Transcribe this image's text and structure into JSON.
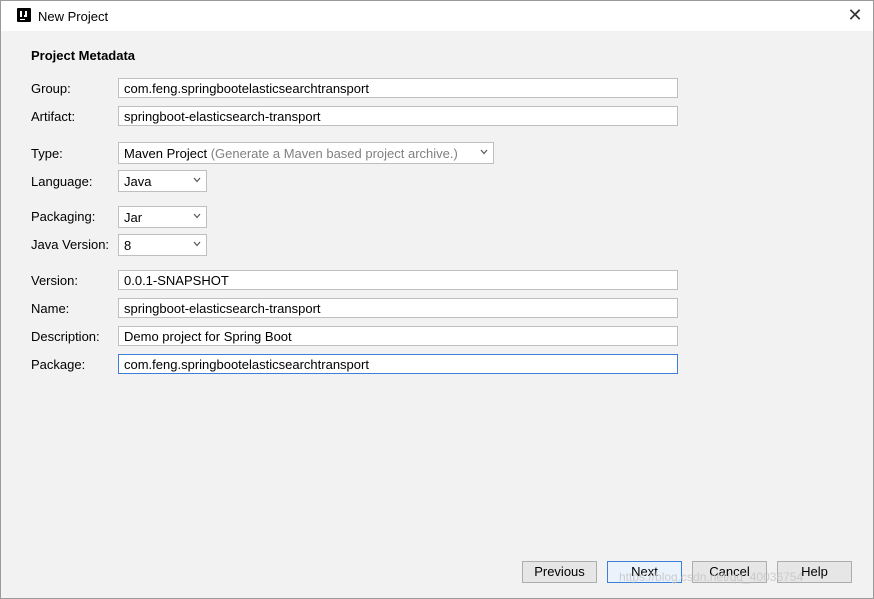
{
  "window": {
    "title": "New Project",
    "close_glyph": "✕"
  },
  "section": {
    "title": "Project Metadata"
  },
  "fields": {
    "group": {
      "label": "Group:",
      "value": "com.feng.springbootelasticsearchtransport"
    },
    "artifact": {
      "label": "Artifact:",
      "value": "springboot-elasticsearch-transport"
    },
    "type": {
      "label": "Type:",
      "value": "Maven Project",
      "hint": "(Generate a Maven based project archive.)"
    },
    "language": {
      "label": "Language:",
      "value": "Java"
    },
    "packaging": {
      "label": "Packaging:",
      "value": "Jar"
    },
    "java_version": {
      "label": "Java Version:",
      "value": "8"
    },
    "version": {
      "label": "Version:",
      "value": "0.0.1-SNAPSHOT"
    },
    "name": {
      "label": "Name:",
      "value": "springboot-elasticsearch-transport"
    },
    "description": {
      "label": "Description:",
      "value": "Demo project for Spring Boot"
    },
    "package": {
      "label": "Package:",
      "value": "com.feng.springbootelasticsearchtransport"
    }
  },
  "buttons": {
    "previous": "Previous",
    "next": "Next",
    "cancel": "Cancel",
    "help": "Help"
  },
  "watermark": "https://blog.csdn.net/qq_40036754",
  "icons": {
    "app": "intellij-icon",
    "close": "close-icon",
    "dropdown": "chevron-down-icon"
  },
  "colors": {
    "focus_border": "#3b7fd8",
    "dialog_bg": "#f2f2f2"
  }
}
